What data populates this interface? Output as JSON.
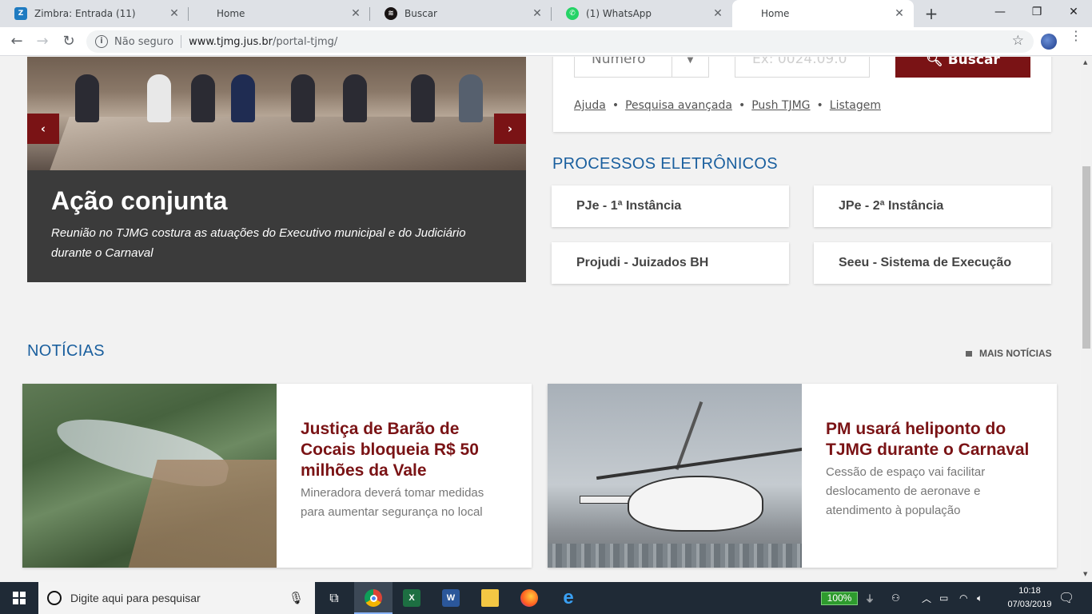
{
  "browser": {
    "tabs": [
      {
        "title": "Zimbra: Entrada (11)",
        "icon": "zimbra-icon",
        "color": "#1f7bc1"
      },
      {
        "title": "Home",
        "icon": "blank-page-icon",
        "color": "#ffffff"
      },
      {
        "title": "Buscar",
        "icon": "spotify-icon",
        "color": "#191414"
      },
      {
        "title": "(1) WhatsApp",
        "icon": "whatsapp-icon",
        "color": "#25d366"
      },
      {
        "title": "Home",
        "icon": "blank-page-icon",
        "color": "#ffffff"
      }
    ],
    "active_tab": 4,
    "security_label": "Não seguro",
    "url_host": "www.tjmg.jus.br",
    "url_path": "/portal-tjmg/"
  },
  "carousel": {
    "title": "Ação conjunta",
    "subtitle": "Reunião no TJMG costura as atuações do Executivo municipal e do Judiciário durante o Carnaval",
    "prev_label": "‹",
    "next_label": "›"
  },
  "search": {
    "select_value": "Número",
    "input_placeholder": "Ex: 0024.09.0",
    "button_label": "Buscar",
    "links": [
      "Ajuda",
      "Pesquisa avançada",
      "Push TJMG",
      "Listagem"
    ]
  },
  "processos": {
    "title": "PROCESSOS ELETRÔNICOS",
    "items": [
      "PJe - 1ª Instância",
      "JPe - 2ª Instância",
      "Projudi - Juizados BH",
      "Seeu - Sistema de Execução"
    ]
  },
  "noticias": {
    "title": "NOTÍCIAS",
    "more_label": "MAIS NOTÍCIAS",
    "items": [
      {
        "headline": "Justiça de Barão de Cocais bloqueia R$ 50 milhões da Vale",
        "summary": "Mineradora deverá tomar medidas para aumentar segurança no local"
      },
      {
        "headline": "PM usará heliponto do TJMG durante o Carnaval",
        "summary": "Cessão de espaço vai facilitar deslocamento de aeronave e atendimento à população"
      }
    ]
  },
  "taskbar": {
    "search_placeholder": "Digite aqui para pesquisar",
    "battery": "100%",
    "time": "10:18",
    "date": "07/03/2019"
  },
  "colors": {
    "brand_red": "#7a1315",
    "brand_blue": "#1a5f9e"
  }
}
